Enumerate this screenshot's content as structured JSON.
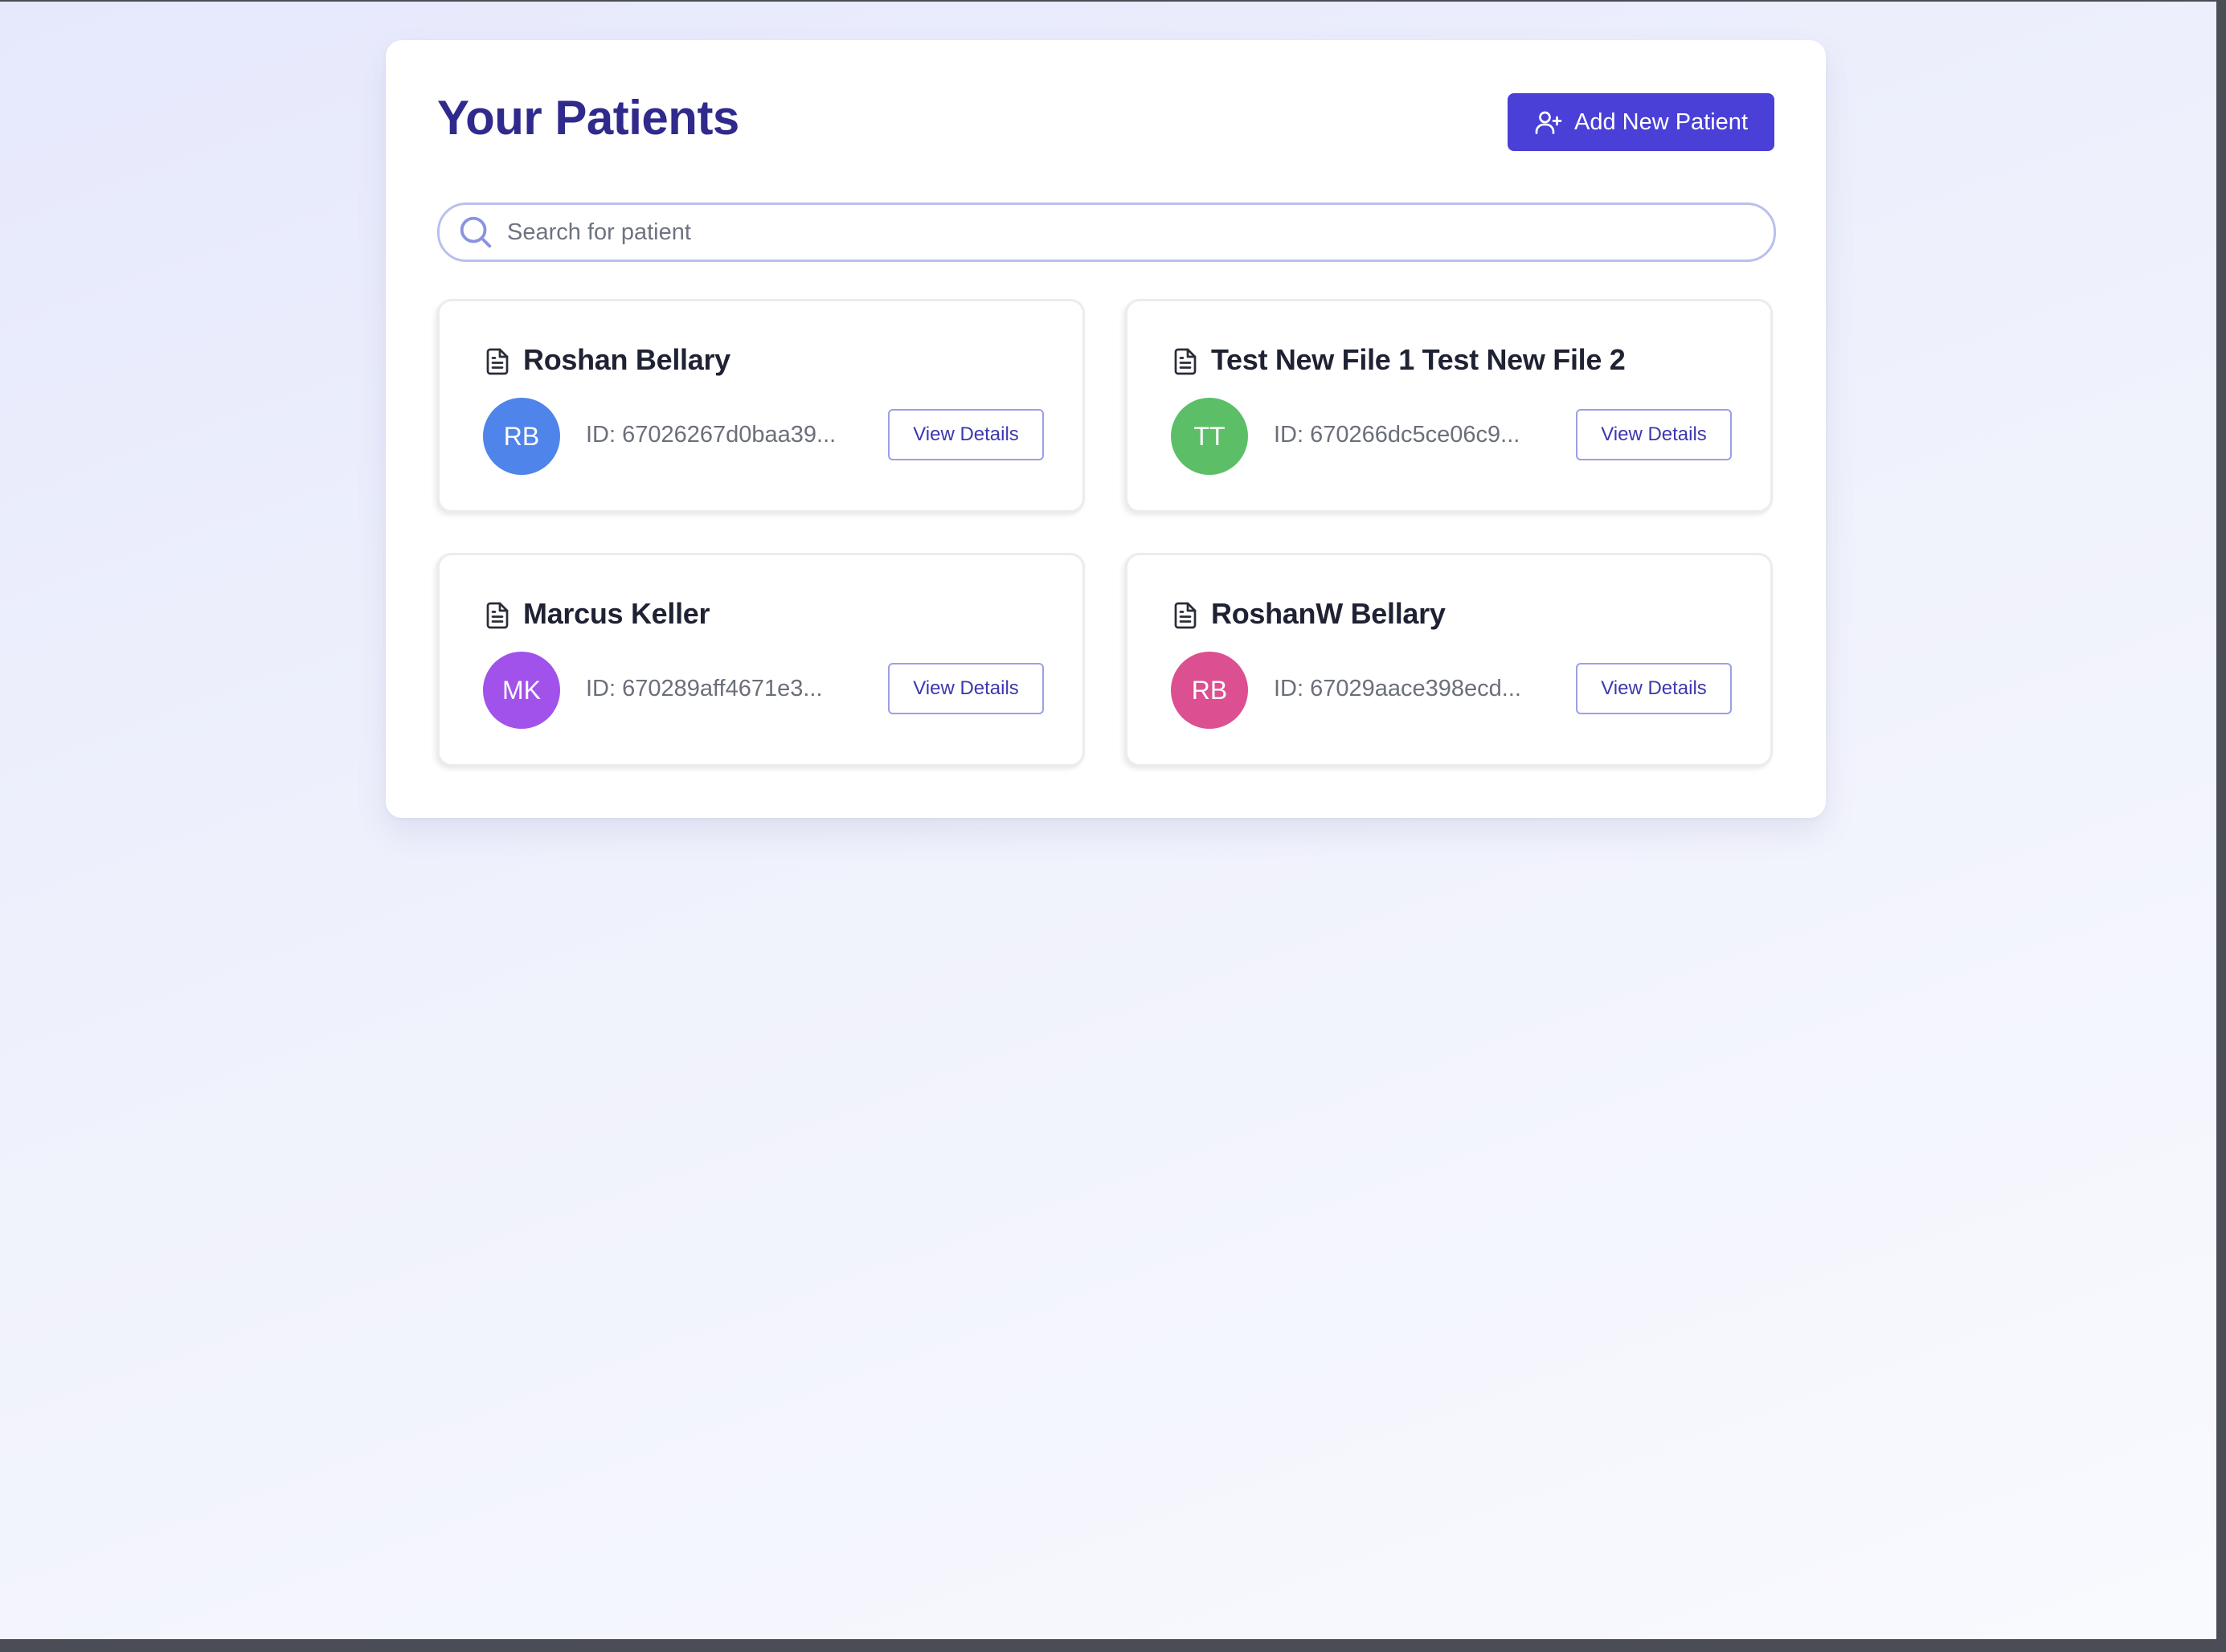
{
  "header": {
    "title": "Your Patients",
    "add_button_label": "Add New Patient"
  },
  "search": {
    "placeholder": "Search for patient",
    "value": ""
  },
  "patients": [
    {
      "name": "Roshan Bellary",
      "initials": "RB",
      "id_text": "ID: 67026267d0baa39...",
      "avatar_color": "#4f84ea",
      "button_label": "View Details"
    },
    {
      "name": "Test New File 1 Test New File 2",
      "initials": "TT",
      "id_text": "ID: 670266dc5ce06c9...",
      "avatar_color": "#5cbf68",
      "button_label": "View Details"
    },
    {
      "name": "Marcus Keller",
      "initials": "MK",
      "id_text": "ID: 670289aff4671e3...",
      "avatar_color": "#a052ea",
      "button_label": "View Details"
    },
    {
      "name": "RoshanW Bellary",
      "initials": "RB",
      "id_text": "ID: 67029aace398ecd...",
      "avatar_color": "#dc4f91",
      "button_label": "View Details"
    }
  ],
  "colors": {
    "accent": "#4a3fd6",
    "title": "#2f2a8c"
  },
  "icons": {
    "add_button": "user-plus-icon",
    "search": "search-icon",
    "card": "document-icon"
  }
}
